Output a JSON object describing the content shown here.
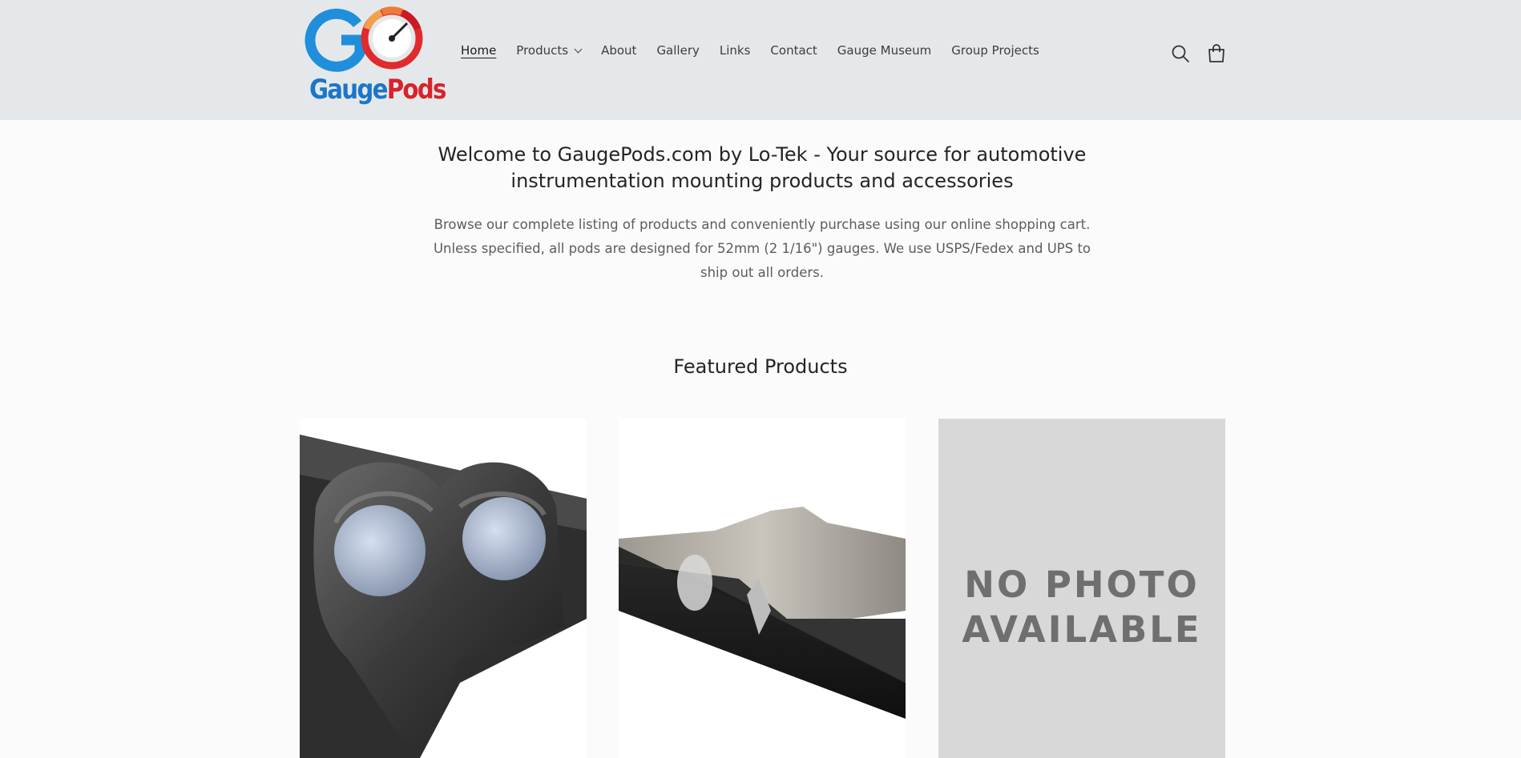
{
  "site": {
    "logo_top": "GO",
    "logo_word_1": "Gauge",
    "logo_word_2": "Pods"
  },
  "nav": {
    "items": [
      {
        "label": "Home",
        "active": true
      },
      {
        "label": "Products",
        "has_dropdown": true
      },
      {
        "label": "About"
      },
      {
        "label": "Gallery"
      },
      {
        "label": "Links"
      },
      {
        "label": "Contact"
      },
      {
        "label": "Gauge Museum"
      },
      {
        "label": "Group Projects"
      }
    ]
  },
  "icons": {
    "search": "search-icon",
    "cart": "cart-icon",
    "dropdown": "chevron-down-icon"
  },
  "welcome": {
    "title_line1": "Welcome to GaugePods.com by Lo-Tek - Your source for automotive",
    "title_line2": "instrumentation mounting products and accessories",
    "desc_line1": "Browse our complete listing of products and conveniently purchase using our online shopping cart.",
    "desc_line2": "Unless specified, all pods are designed for 52mm (2 1/16\") gauges. We use USPS/Fedex and UPS to",
    "desc_line3": "ship out all orders."
  },
  "featured": {
    "title": "Featured Products",
    "placeholder_line1": "NO PHOTO",
    "placeholder_line2": "AVAILABLE"
  },
  "colors": {
    "header_bg": "#e5e8ea",
    "page_bg": "#fbfbfb",
    "brand_blue": "#1b76c9",
    "brand_red": "#d8232a",
    "placeholder_bg": "#d8d8d8"
  }
}
